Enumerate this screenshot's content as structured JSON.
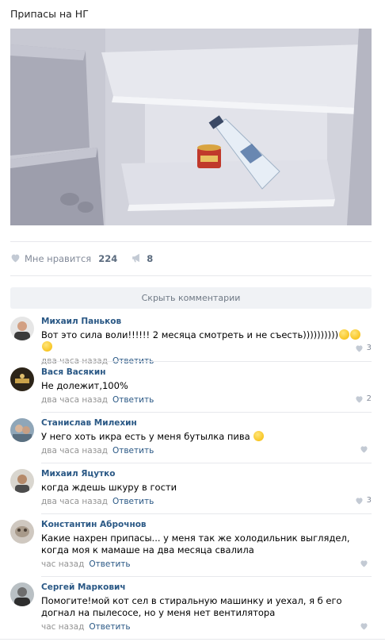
{
  "post": {
    "title": "Припасы на НГ",
    "likes_label": "Мне нравится",
    "likes_count": "224",
    "shares_count": "8"
  },
  "hide_comments_label": "Скрыть комментарии",
  "comments": [
    {
      "author": "Михаил Паньков",
      "text": "Вот это сила воли!!!!!! 2 месяца смотреть и не съесть))))))))))",
      "time": "два часа назад",
      "reply": "Ответить",
      "likes": "3"
    },
    {
      "author": "Вася Васякин",
      "text": "Не долежит,100%",
      "time": "два часа назад",
      "reply": "Ответить",
      "likes": "2"
    },
    {
      "author": "Станислав Милехин",
      "text": "У него хоть икра есть у меня бутылка пива",
      "time": "два часа назад",
      "reply": "Ответить",
      "likes": ""
    },
    {
      "author": "Михаил Яцутко",
      "text": "когда ждешь шкуру в гости",
      "time": "два часа назад",
      "reply": "Ответить",
      "likes": "3"
    },
    {
      "author": "Константин Аброчнов",
      "text": "Какие нахрен припасы... у меня так же холодильник выглядел, когда моя к мамаше на два месяца свалила",
      "time": "час назад",
      "reply": "Ответить",
      "likes": ""
    },
    {
      "author": "Сергей Маркович",
      "text": "Помогите!мой кот сел в стиральную машинку и уехал, я б его догнал на пылесосе, но у меня нет вентилятора",
      "time": "час назад",
      "reply": "Ответить",
      "likes": ""
    }
  ],
  "colors": {
    "link": "#2a5885",
    "meta": "#939393",
    "divider": "#e7e8ec",
    "button_bg": "#f0f2f5"
  },
  "icons": {
    "like": "heart-icon",
    "share": "megaphone-icon"
  }
}
